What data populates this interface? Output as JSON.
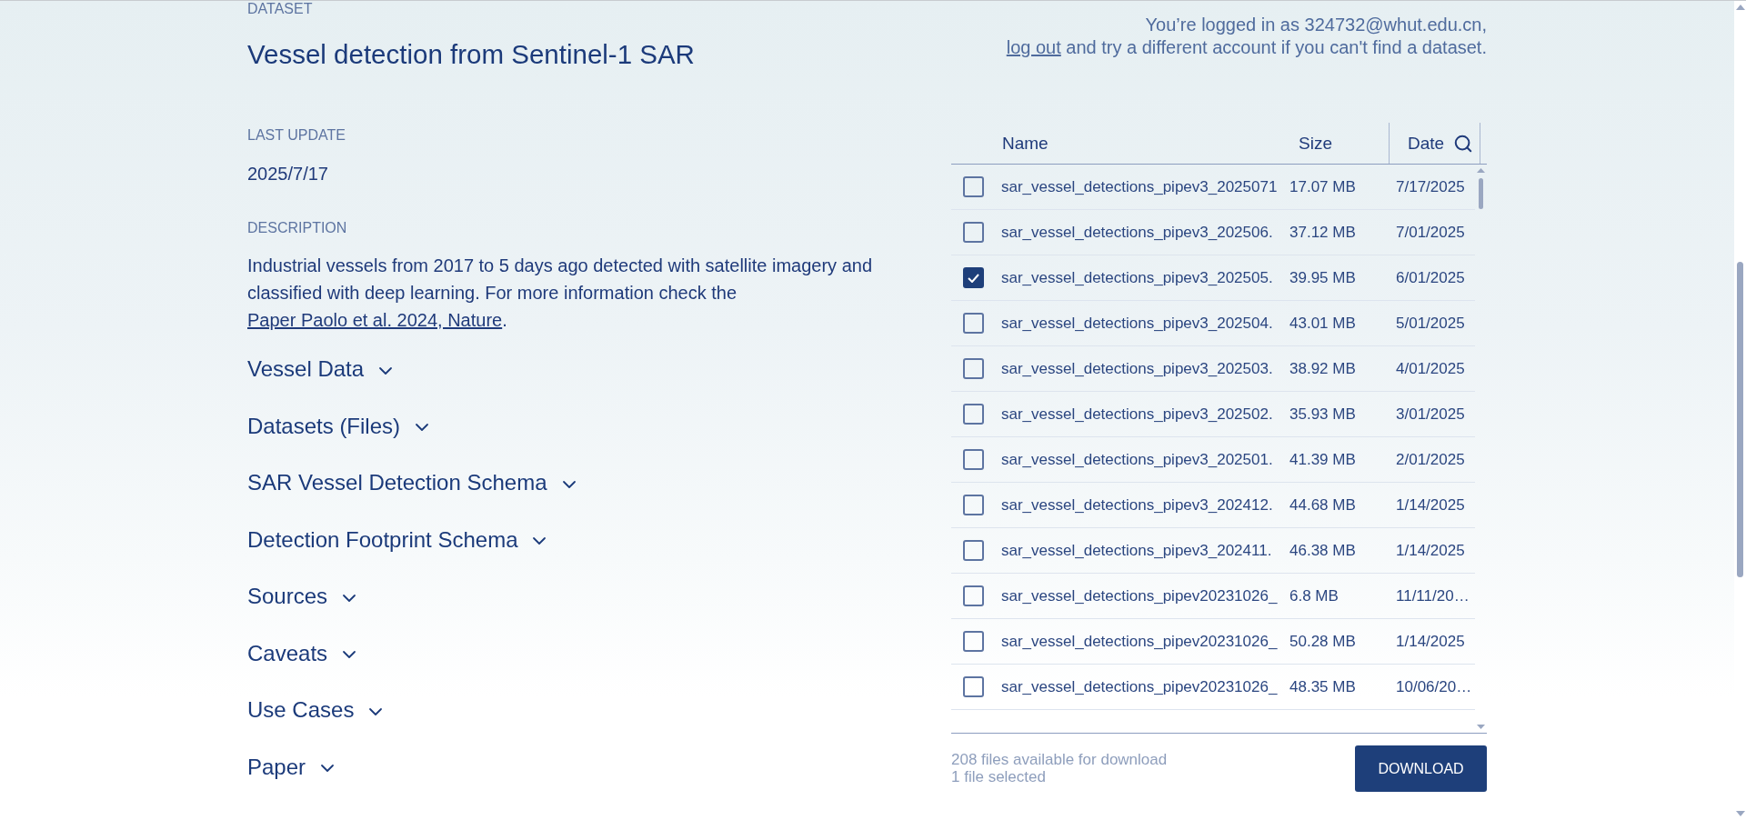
{
  "header": {
    "eyebrow": "DATASET",
    "title": "Vessel detection from Sentinel-1 SAR"
  },
  "last_update": {
    "label": "LAST UPDATE",
    "value": "2025/7/17"
  },
  "description": {
    "label": "DESCRIPTION",
    "text": "Industrial vessels from 2017 to 5 days ago detected with satellite imagery and classified with deep learning. For more information check the",
    "link": "Paper Paolo et al. 2024, Nature",
    "text_end": "."
  },
  "sections": [
    {
      "label": "Vessel Data",
      "expanded": false
    },
    {
      "label": "Datasets (Files)",
      "expanded": false
    },
    {
      "label": "SAR Vessel Detection Schema",
      "expanded": false
    },
    {
      "label": "Detection Footprint Schema",
      "expanded": false
    },
    {
      "label": "Sources",
      "expanded": false
    },
    {
      "label": "Caveats",
      "expanded": false
    },
    {
      "label": "Use Cases",
      "expanded": false
    },
    {
      "label": "Paper",
      "expanded": false
    }
  ],
  "account": {
    "line_1": "You’re logged in as 324732@whut.edu.cn,",
    "logout_link": "log out",
    "line_2": "and try a different account if you can't find a dataset."
  },
  "files": {
    "columns": [
      {
        "label": "Name"
      },
      {
        "label": "Size"
      },
      {
        "label": "Date"
      }
    ],
    "rows": [
      {
        "name": "sar_vessel_detections_pipev3_2025071",
        "size": "17.07 MB",
        "date": "7/17/2025",
        "checked": false
      },
      {
        "name": "sar_vessel_detections_pipev3_202506.",
        "size": "37.12 MB",
        "date": "7/01/2025",
        "checked": false
      },
      {
        "name": "sar_vessel_detections_pipev3_202505.",
        "size": "39.95 MB",
        "date": "6/01/2025",
        "checked": true
      },
      {
        "name": "sar_vessel_detections_pipev3_202504.",
        "size": "43.01 MB",
        "date": "5/01/2025",
        "checked": false
      },
      {
        "name": "sar_vessel_detections_pipev3_202503.",
        "size": "38.92 MB",
        "date": "4/01/2025",
        "checked": false
      },
      {
        "name": "sar_vessel_detections_pipev3_202502.",
        "size": "35.93 MB",
        "date": "3/01/2025",
        "checked": false
      },
      {
        "name": "sar_vessel_detections_pipev3_202501.",
        "size": "41.39 MB",
        "date": "2/01/2025",
        "checked": false
      },
      {
        "name": "sar_vessel_detections_pipev3_202412.",
        "size": "44.68 MB",
        "date": "1/14/2025",
        "checked": false
      },
      {
        "name": "sar_vessel_detections_pipev3_202411.",
        "size": "46.38 MB",
        "date": "1/14/2025",
        "checked": false
      },
      {
        "name": "sar_vessel_detections_pipev20231026_",
        "size": "6.8 MB",
        "date": "11/11/20…",
        "checked": false
      },
      {
        "name": "sar_vessel_detections_pipev20231026_",
        "size": "50.28 MB",
        "date": "1/14/2025",
        "checked": false
      },
      {
        "name": "sar_vessel_detections_pipev20231026_",
        "size": "48.35 MB",
        "date": "10/06/20…",
        "checked": false
      }
    ],
    "available": "208 files available for download",
    "selection_summary": "1 file selected",
    "download_button": "DOWNLOAD"
  }
}
